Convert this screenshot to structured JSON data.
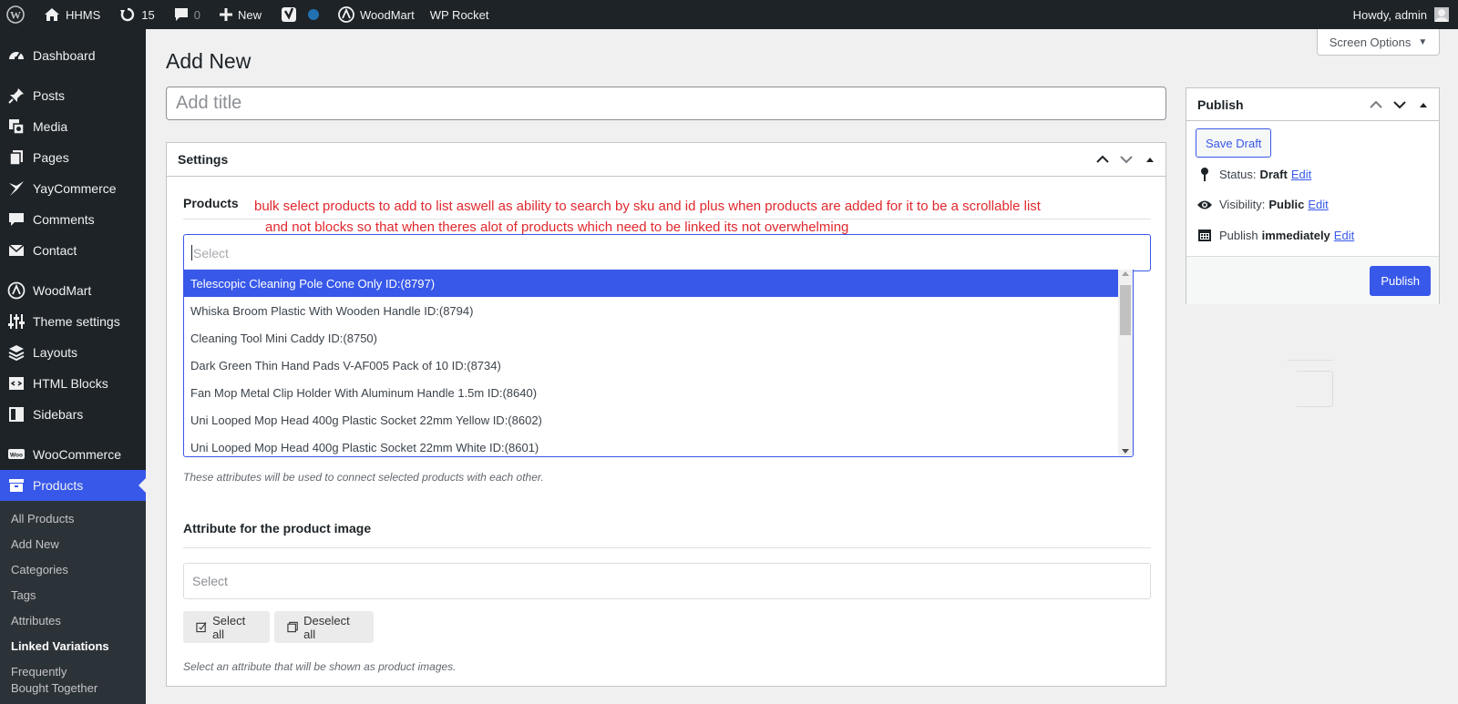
{
  "adminbar": {
    "site_name": "HHMS",
    "updates_count": "15",
    "comments_count": "0",
    "new_label": "New",
    "woodmart_label": "WoodMart",
    "wprocket_label": "WP Rocket",
    "howdy": "Howdy, admin"
  },
  "sidebar": {
    "items": [
      {
        "label": "Dashboard",
        "icon": "dashboard-icon"
      },
      {
        "label": "Posts",
        "icon": "pushpin-icon"
      },
      {
        "label": "Media",
        "icon": "media-icon"
      },
      {
        "label": "Pages",
        "icon": "pages-icon"
      },
      {
        "label": "YayCommerce",
        "icon": "yaycommerce-icon"
      },
      {
        "label": "Comments",
        "icon": "comment-icon"
      },
      {
        "label": "Contact",
        "icon": "envelope-icon"
      },
      {
        "label": "WoodMart",
        "icon": "woodmart-icon"
      },
      {
        "label": "Theme settings",
        "icon": "sliders-icon"
      },
      {
        "label": "Layouts",
        "icon": "layers-icon"
      },
      {
        "label": "HTML Blocks",
        "icon": "html-icon"
      },
      {
        "label": "Sidebars",
        "icon": "sidebar-icon"
      },
      {
        "label": "WooCommerce",
        "icon": "woo-icon"
      },
      {
        "label": "Products",
        "icon": "archive-icon"
      }
    ],
    "submenu": [
      "All Products",
      "Add New",
      "Categories",
      "Tags",
      "Attributes",
      "Linked Variations",
      "Frequently Bought Together"
    ]
  },
  "screen_options": "Screen Options",
  "page_title": "Add New",
  "title_placeholder": "Add title",
  "settings": {
    "title": "Settings",
    "products_label": "Products",
    "annotation_line1": "bulk select products to add to list aswell as ability to search by sku and id plus when products are added for it to be a scrollable list",
    "annotation_line2": "and not blocks so that when theres alot of products which need to be linked its not overwhelming",
    "select_placeholder": "Select",
    "dropdown_options": [
      "Telescopic Cleaning Pole Cone Only ID:(8797)",
      "Whiska Broom Plastic With Wooden Handle ID:(8794)",
      "Cleaning Tool Mini Caddy ID:(8750)",
      "Dark Green Thin Hand Pads V-AF005 Pack of 10 ID:(8734)",
      "Fan Mop Metal Clip Holder With Aluminum Handle 1.5m ID:(8640)",
      "Uni Looped Mop Head 400g Plastic Socket 22mm Yellow ID:(8602)",
      "Uni Looped Mop Head 400g Plastic Socket 22mm White ID:(8601)"
    ],
    "attributes_help": "These attributes will be used to connect selected products with each other.",
    "attr_image_label": "Attribute for the product image",
    "attr_image_placeholder": "Select",
    "select_all": "Select all",
    "deselect_all": "Deselect all",
    "image_help": "Select an attribute that will be shown as product images."
  },
  "publish": {
    "title": "Publish",
    "save_draft": "Save Draft",
    "status_label": "Status:",
    "status_value": "Draft",
    "visibility_label": "Visibility:",
    "visibility_value": "Public",
    "publish_label": "Publish",
    "publish_value": "immediately",
    "edit": "Edit",
    "publish_button": "Publish"
  },
  "colors": {
    "accent": "#3858e9",
    "adminbar": "#1d2327",
    "annotation": "#e0282e"
  }
}
